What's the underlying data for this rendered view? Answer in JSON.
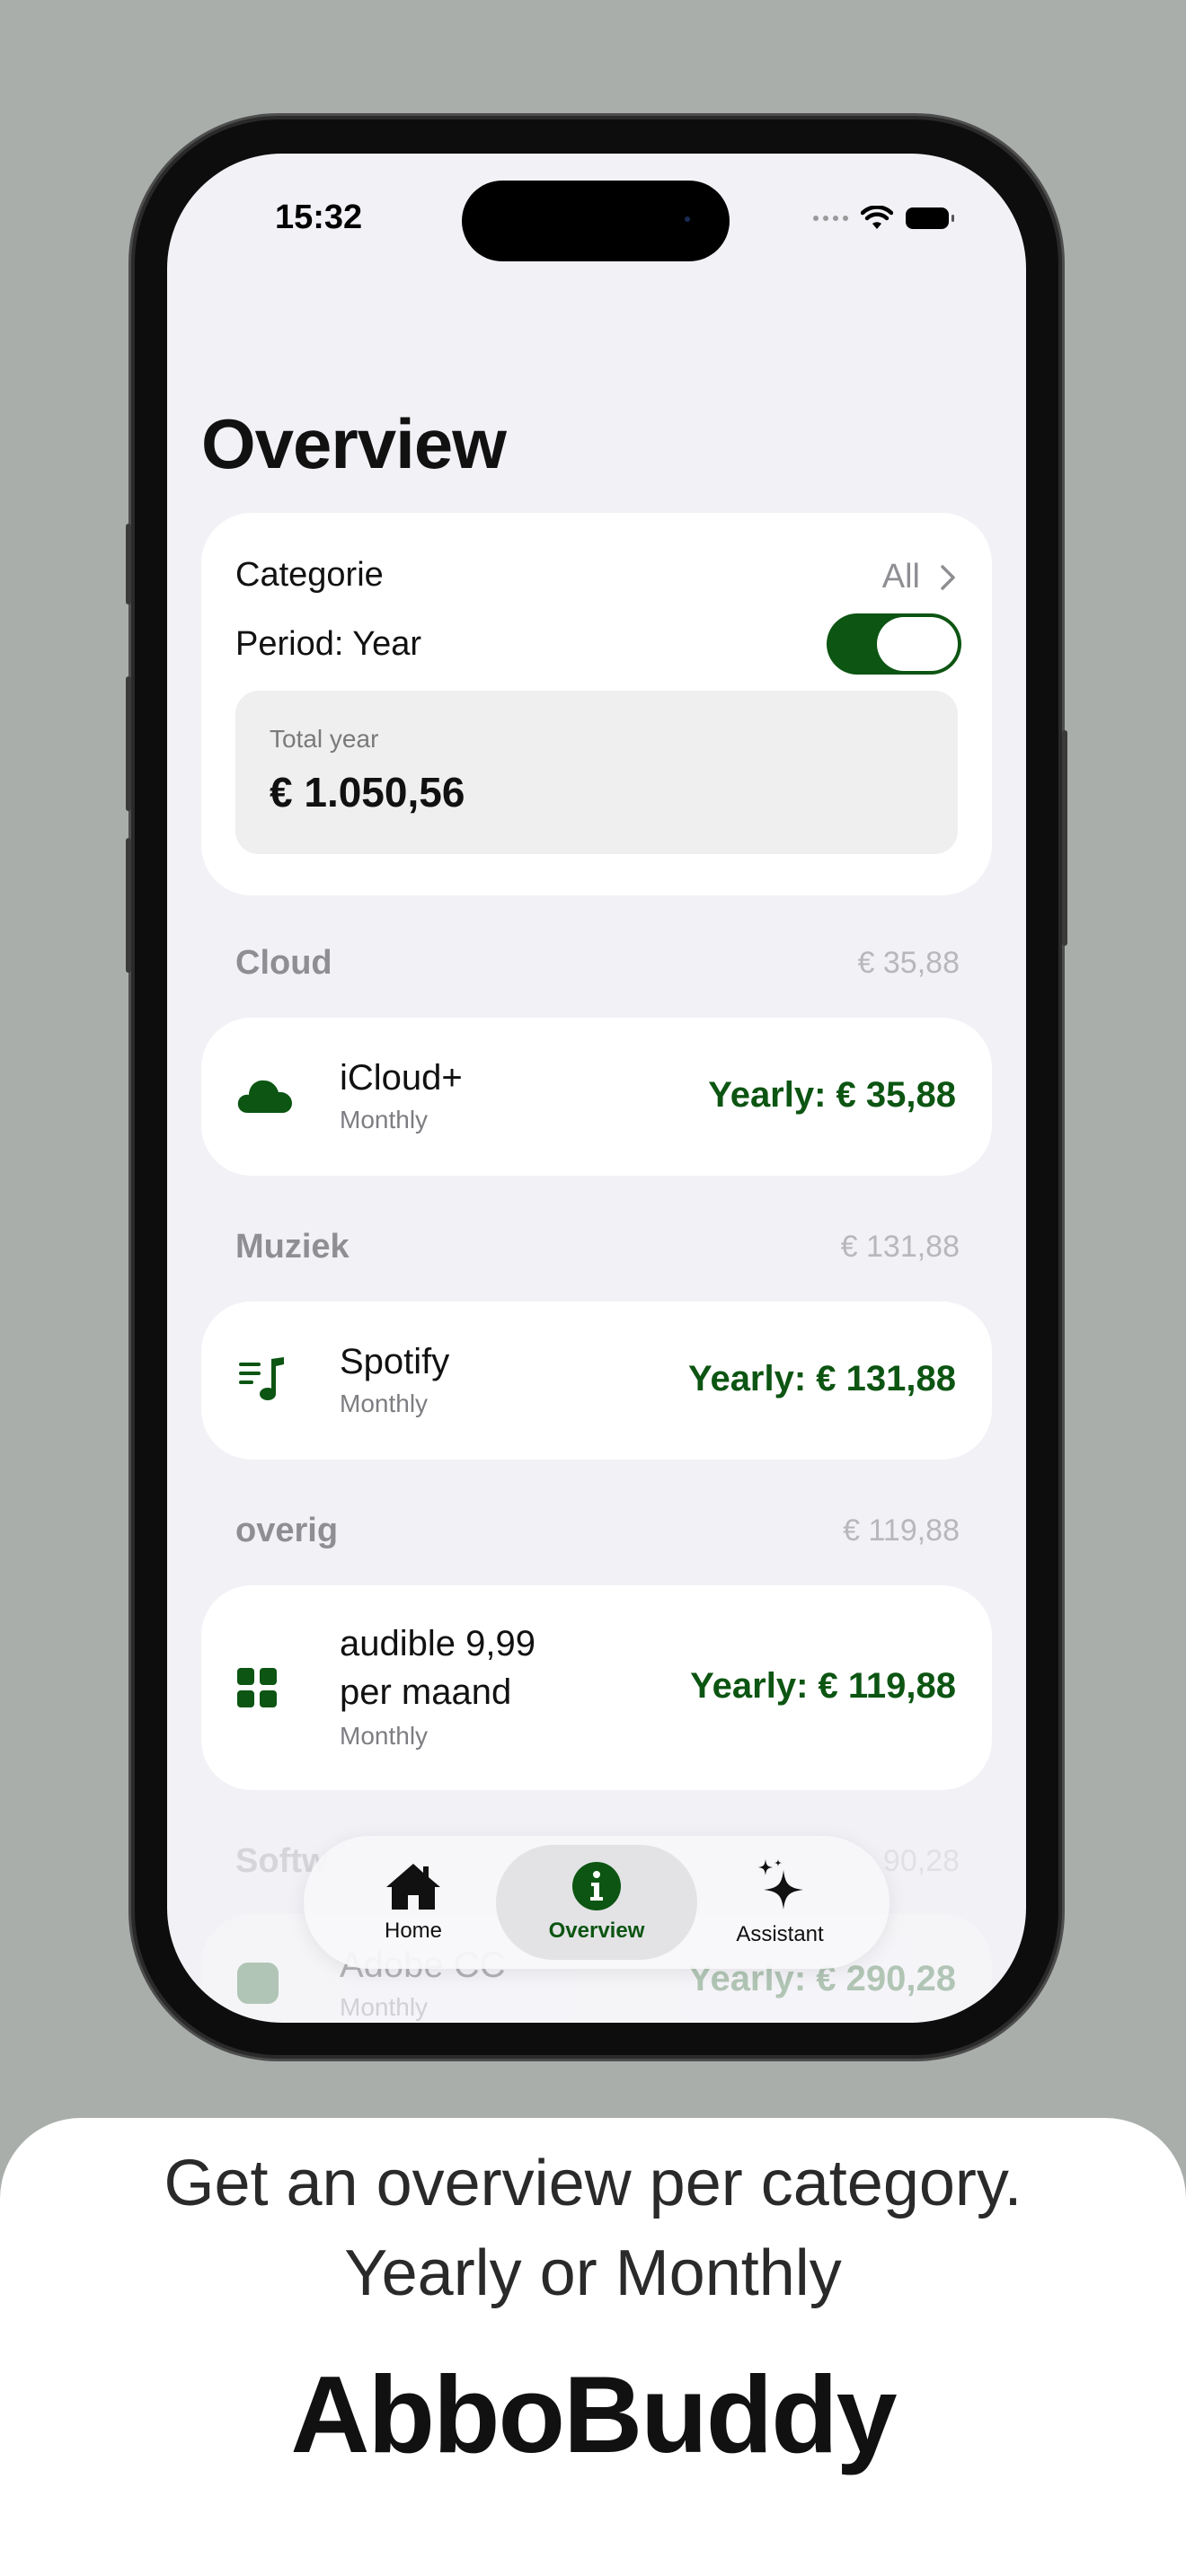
{
  "status_bar": {
    "time": "15:32"
  },
  "title": "Overview",
  "filters": {
    "category_label": "Categorie",
    "category_value": "All",
    "period_label": "Period: Year",
    "period_toggle_on": true
  },
  "total": {
    "label": "Total year",
    "value": "€ 1.050,56"
  },
  "sections": [
    {
      "name": "Cloud",
      "total": "€ 35,88",
      "item": {
        "name": "iCloud+",
        "cycle": "Monthly",
        "price": "Yearly: € 35,88",
        "icon": "cloud-icon"
      }
    },
    {
      "name": "Muziek",
      "total": "€ 131,88",
      "item": {
        "name": "Spotify",
        "cycle": "Monthly",
        "price": "Yearly: € 131,88",
        "icon": "music-list-icon"
      }
    },
    {
      "name": "overig",
      "total": "€ 119,88",
      "item": {
        "name_line1": "audible 9,99",
        "name_line2": "per maand",
        "cycle": "Monthly",
        "price": "Yearly: € 119,88",
        "icon": "grid-icon"
      }
    },
    {
      "name": "Softw",
      "total": "90,28",
      "item": {
        "name": "Adobe CC",
        "cycle": "Monthly",
        "price": "Yearly: € 290,28",
        "icon": "app-icon"
      }
    }
  ],
  "tabbar": {
    "tabs": [
      {
        "label": "Home",
        "icon": "house-icon",
        "active": false
      },
      {
        "label": "Overview",
        "icon": "info-icon",
        "active": true
      },
      {
        "label": "Assistant",
        "icon": "sparkles-icon",
        "active": false
      }
    ]
  },
  "caption": {
    "line1": "Get an overview per category.",
    "line2": "Yearly or Monthly",
    "brand": "AbboBuddy"
  },
  "colors": {
    "accent": "#0c5512",
    "background": "#a9aeaa",
    "screen": "#f2f1f6"
  }
}
